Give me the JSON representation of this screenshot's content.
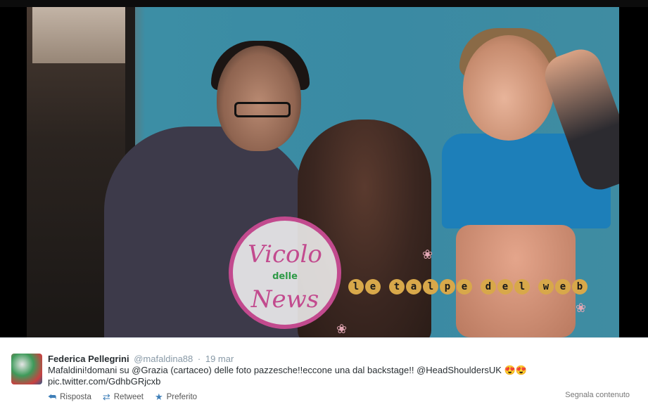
{
  "watermark": {
    "circle_top": "Vicolo",
    "circle_mid": "delle",
    "circle_bottom": "News",
    "talpe": "le talpe del web"
  },
  "tweet": {
    "author_name": "Federica Pellegrini",
    "author_handle": "@mafaldina88",
    "separator": "·",
    "timestamp": "19 mar",
    "text": "Mafaldini!domani su @Grazia (cartaceo) delle foto pazzesche!!eccone una dal backstage!! @HeadShouldersUK 😍😍",
    "link": "pic.twitter.com/GdhbGRjcxb",
    "actions": {
      "reply_label": "Risposta",
      "retweet_label": "Retweet",
      "favorite_label": "Preferito"
    },
    "report_label": "Segnala contenuto"
  },
  "icons": {
    "reply": "reply-icon",
    "retweet": "retweet-icon",
    "favorite": "star-icon"
  },
  "colors": {
    "action_icon": "#3f7fb8",
    "watermark_pink": "#c24a8e",
    "watermark_green": "#2e9a47"
  }
}
